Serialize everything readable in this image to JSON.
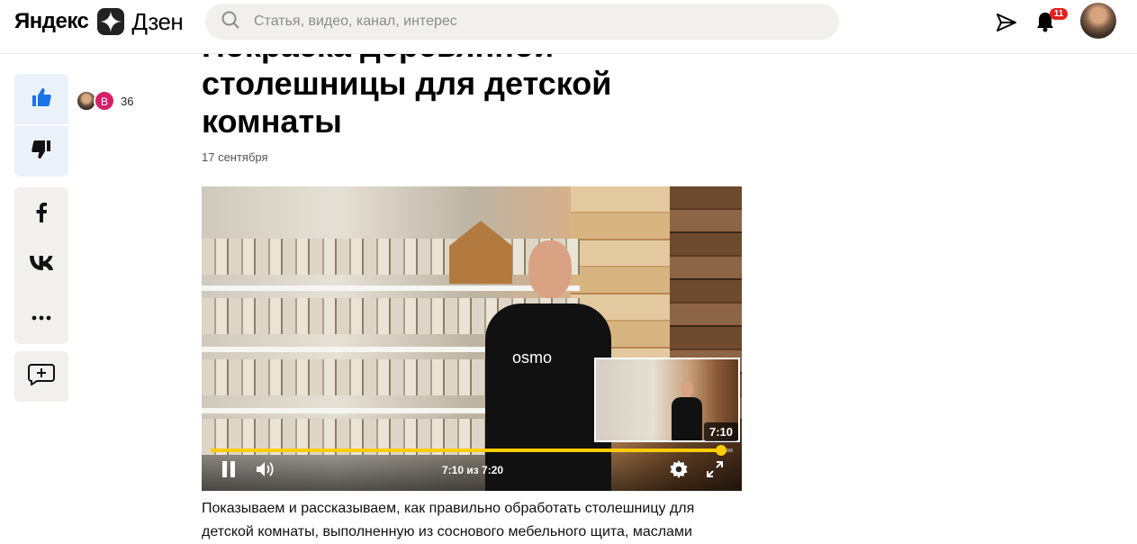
{
  "header": {
    "logo_brand": "Яндекс",
    "logo_product": "Дзен",
    "search_placeholder": "Статья, видео, канал, интерес",
    "notifications_count": "11",
    "icons": [
      "search-icon",
      "send-icon",
      "bell-icon"
    ]
  },
  "reactions": {
    "avatar_letter": "В",
    "count": "36"
  },
  "article": {
    "title": "Покраска деревянной столешницы для детской комнаты",
    "date": "17 сентября",
    "body": "Показываем и рассказываем, как правильно обработать столешницу для детской комнаты, выполненную из соснового мебельного щита, маслами"
  },
  "video": {
    "shirt_logo": "osmo",
    "preview_time": "7:10",
    "time_label": "7:10 из 7:20",
    "progress": 0.977
  },
  "colors": {
    "accent": "#ffcc00",
    "badge": "#e31f1f",
    "like_bg": "#ebf1fb",
    "like_icon": "#1a73e8",
    "rail_bg": "#f1f0ed"
  }
}
